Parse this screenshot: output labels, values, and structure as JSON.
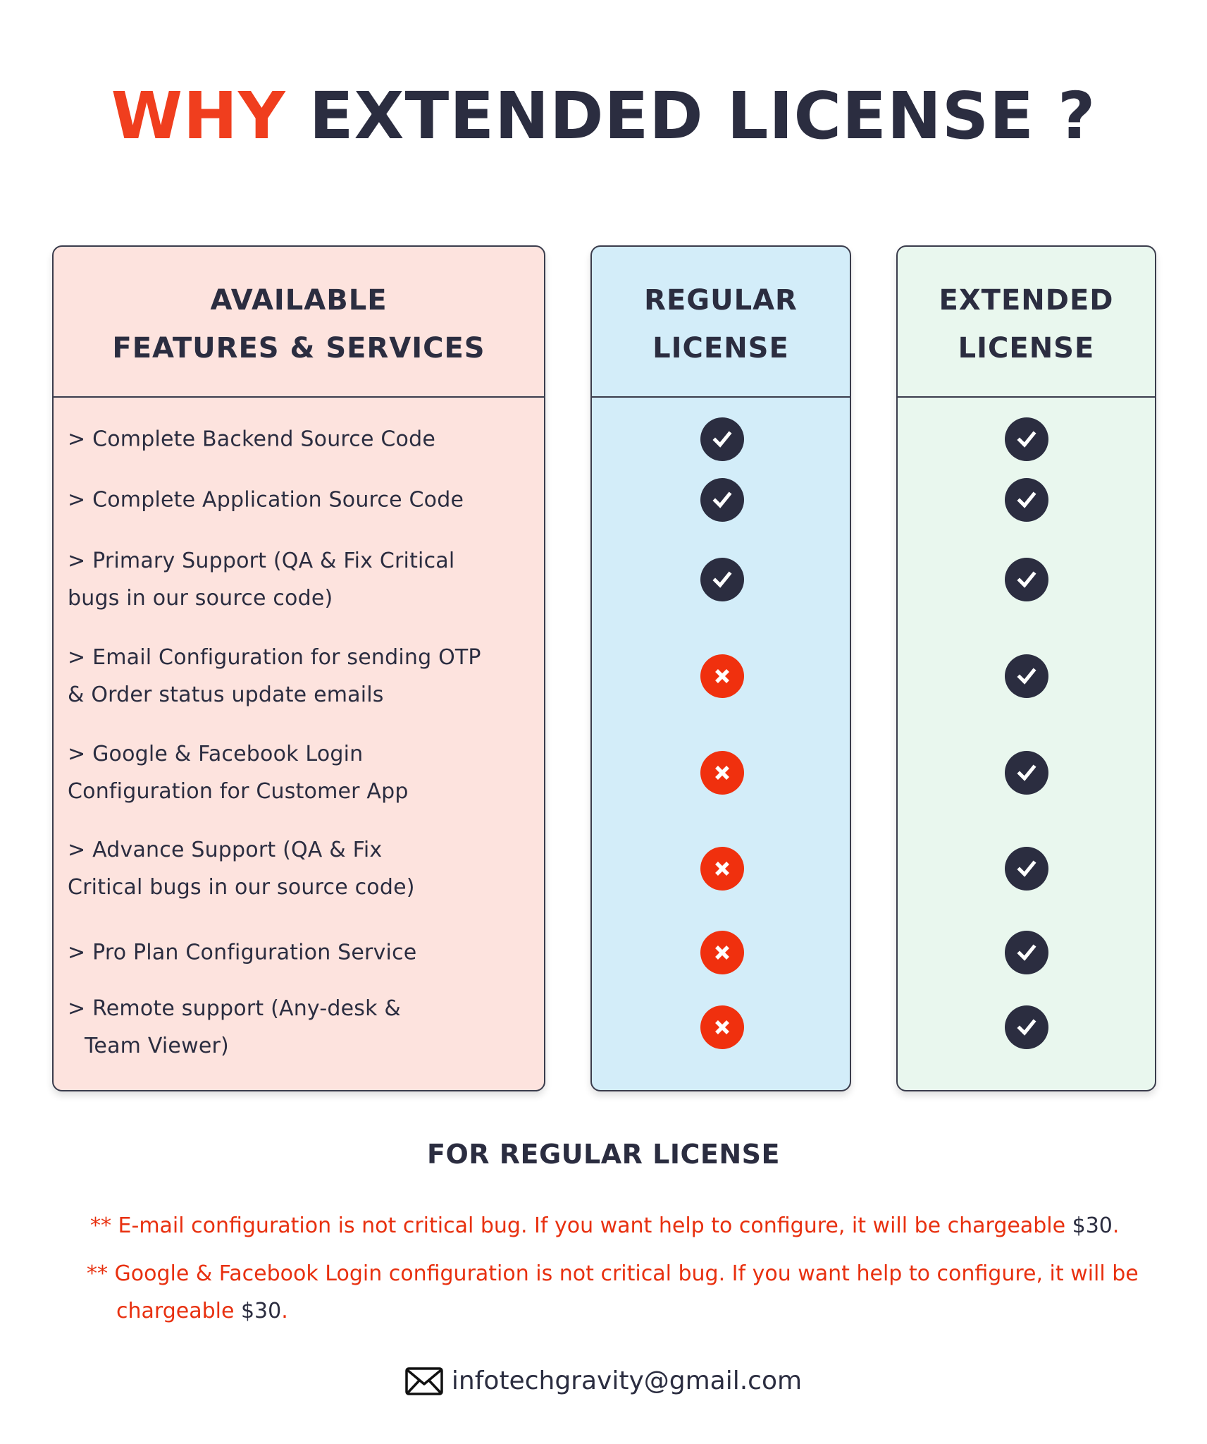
{
  "title": {
    "accent": "WHY",
    "main": "EXTENDED LICENSE ?"
  },
  "columns": {
    "features": {
      "line1": "AVAILABLE",
      "line2": "FEATURES & SERVICES"
    },
    "regular": {
      "line1": "REGULAR",
      "line2": "LICENSE"
    },
    "extended": {
      "line1": "EXTENDED",
      "line2": "LICENSE"
    }
  },
  "features": [
    {
      "line1": "> Complete Backend Source Code",
      "line2": "",
      "regular": "check",
      "extended": "check"
    },
    {
      "line1": "> Complete Application Source Code",
      "line2": "",
      "regular": "check",
      "extended": "check"
    },
    {
      "line1": "> Primary Support (QA & Fix Critical",
      "line2": "bugs in our source code)",
      "regular": "check",
      "extended": "check"
    },
    {
      "line1": "> Email Configuration for sending OTP",
      "line2": "& Order status update emails",
      "regular": "cross",
      "extended": "check"
    },
    {
      "line1": "> Google & Facebook Login",
      "line2": "Configuration for Customer App",
      "regular": "cross",
      "extended": "check"
    },
    {
      "line1": "> Advance Support (QA & Fix",
      "line2": "Critical bugs in our source code)",
      "regular": "cross",
      "extended": "check"
    },
    {
      "line1": "> Pro Plan Configuration Service",
      "line2": "",
      "regular": "cross",
      "extended": "check"
    },
    {
      "line1": "> Remote support (Any-desk &",
      "line2": "Team Viewer)",
      "regular": "cross",
      "extended": "check"
    }
  ],
  "icons": {
    "check": "check-circle-icon",
    "cross": "cross-circle-icon",
    "email": "envelope-icon"
  },
  "footer": {
    "subtitle": "FOR REGULAR LICENSE",
    "note1": {
      "text": "** E-mail configuration is not critical bug. If you want help to configure, it will be chargeable ",
      "price": "$30",
      "end": "."
    },
    "note2": {
      "text": "** Google & Facebook Login configuration is not critical bug. If you want help to configure, it will be",
      "cont": "chargeable ",
      "price": "$30",
      "end": "."
    },
    "email": "infotechgravity@gmail.com"
  },
  "colors": {
    "accent_red": "#f03e1e",
    "navy": "#2b2d40",
    "features_bg": "#fde3de",
    "regular_bg": "#d3edf9",
    "extended_bg": "#e9f7ee",
    "cross_red": "#f0300e"
  }
}
